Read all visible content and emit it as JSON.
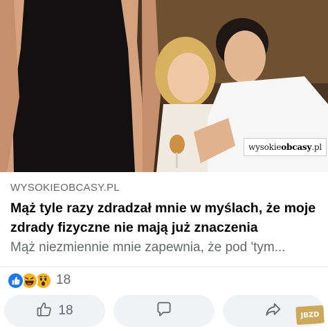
{
  "photo": {
    "alt": "",
    "watermark_regular": "wysokie",
    "watermark_bold": "obcasy",
    "watermark_suffix": ".pl"
  },
  "link_preview": {
    "domain": "WYSOKIEOBCASY.PL",
    "headline": "Mąż tyle razy zdradzał mnie w myślach, że moje zdrady fizyczne nie mają już znaczenia",
    "excerpt": "Mąż niezmiennie mnie zapewnia, że pod 'tym..."
  },
  "reactions": {
    "types": [
      "like-icon",
      "haha-icon",
      "wow-icon"
    ],
    "count": "18"
  },
  "actions": {
    "like_count": "18",
    "like_icon": "thumbs-up-icon",
    "comment_icon": "comment-bubble-icon",
    "share_icon": "share-arrow-icon"
  },
  "overlay": {
    "logo_text": "JBZD"
  },
  "colors": {
    "like_blue": "#1877f2",
    "emoji_yellow": "#f7b125",
    "secondary_text": "#65676b",
    "button_bg": "#f0f2f5"
  }
}
